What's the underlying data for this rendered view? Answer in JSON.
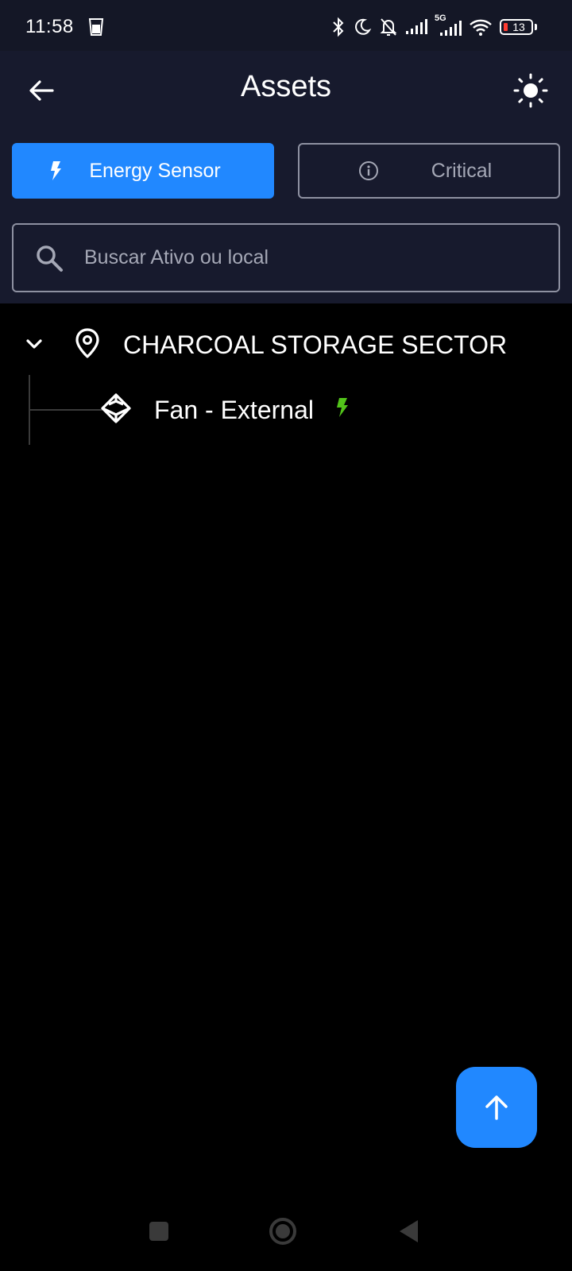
{
  "status_bar": {
    "time": "11:58",
    "network": "5G",
    "battery_level": "13",
    "battery_color": "#ff3b30"
  },
  "app_bar": {
    "title": "Assets",
    "back_icon": "arrow-left-icon",
    "theme_icon": "sun-icon"
  },
  "filters": {
    "energy_label": "Energy Sensor",
    "energy_icon": "bolt-icon",
    "energy_active": true,
    "critical_label": "Critical",
    "critical_icon": "info-circle-icon",
    "critical_active": false
  },
  "search": {
    "placeholder": "Buscar Ativo ou local",
    "value": ""
  },
  "tree": {
    "location": {
      "label": "CHARCOAL STORAGE SECTOR",
      "icon": "location-pin-icon",
      "expanded": true
    },
    "children": [
      {
        "label": "Fan - External",
        "icon": "cube-icon",
        "sensor_icon": "bolt-icon",
        "sensor_color": "#52c41a"
      }
    ]
  },
  "fab": {
    "icon": "arrow-up-icon"
  },
  "colors": {
    "accent": "#2188ff",
    "header_bg": "#171a2d",
    "body_bg": "#000000",
    "border": "#8e91a1"
  }
}
